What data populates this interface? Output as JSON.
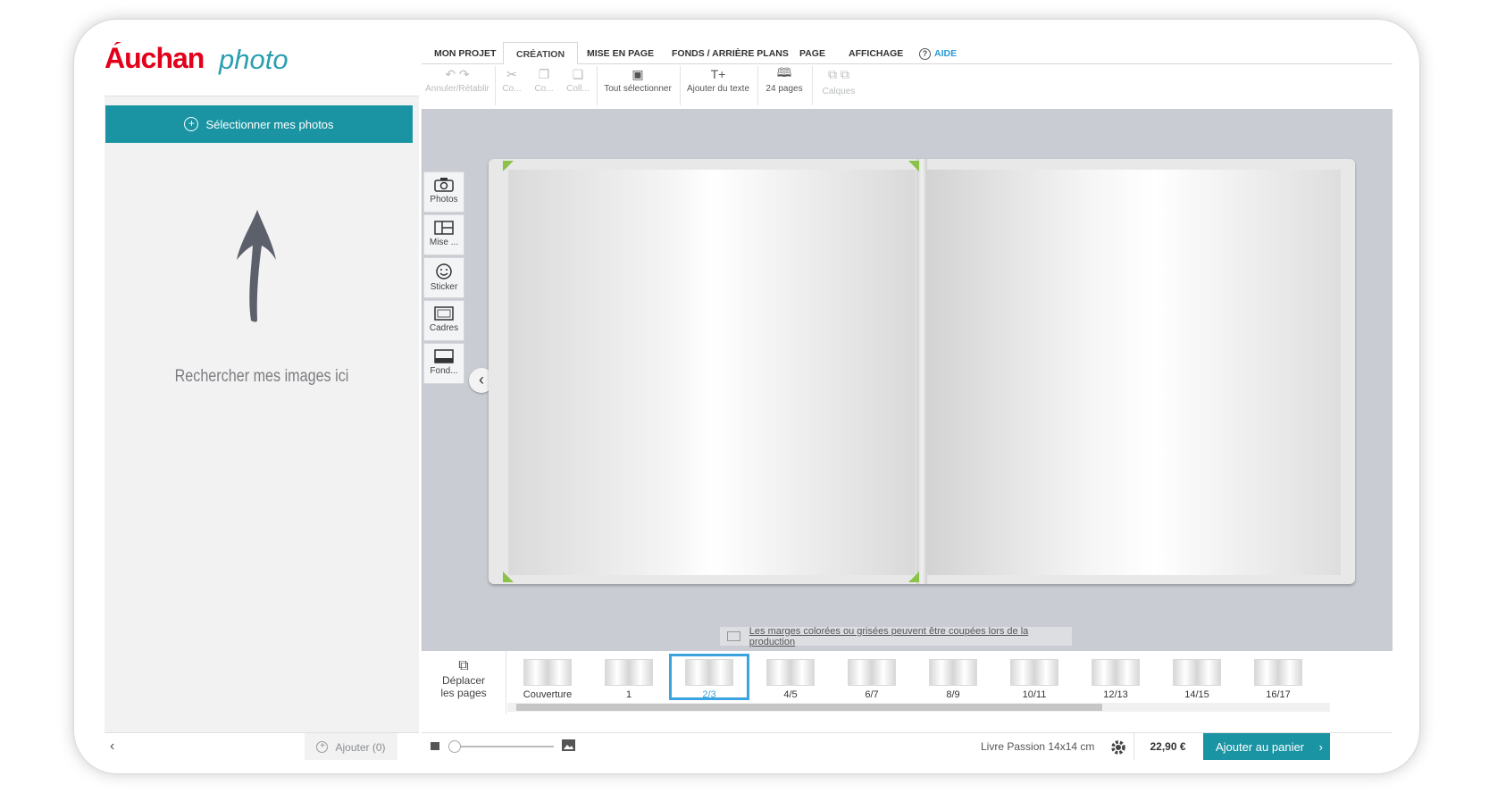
{
  "brand": {
    "name_red": "Auchan",
    "name_blue": "photo"
  },
  "left": {
    "select_button": "Sélectionner mes photos",
    "hint": "Rechercher mes images ici",
    "add_button": "Ajouter (0)"
  },
  "menu": {
    "tabs": [
      "MON PROJET",
      "CRÉATION",
      "MISE EN PAGE",
      "FONDS / ARRIÈRE PLANS",
      "PAGE",
      "AFFICHAGE"
    ],
    "help": "AIDE",
    "active_tab": "CRÉATION"
  },
  "toolbar": {
    "undo_redo": "Annuler/Rétablir",
    "cut": "Co...",
    "copy": "Co...",
    "paste": "Coll...",
    "select_all": "Tout sélectionner",
    "add_text": "Ajouter du texte",
    "pages": "24 pages",
    "layers": "Calques"
  },
  "side_tools": [
    "Photos",
    "Mise ...",
    "Sticker",
    "Cadres",
    "Fond..."
  ],
  "warning": "Les marges colorées ou grisées peuvent être coupées lors de la production",
  "strip": {
    "move_pages": [
      "Déplacer",
      "les pages"
    ],
    "thumbs": [
      "Couverture",
      "1",
      "2/3",
      "4/5",
      "6/7",
      "8/9",
      "10/11",
      "12/13",
      "14/15",
      "16/17"
    ],
    "active_thumb": "2/3"
  },
  "footer": {
    "product": "Livre Passion 14x14 cm",
    "price": "22,90 €",
    "cart_button": "Ajouter au panier"
  },
  "colors": {
    "accent": "#1a94a3",
    "brand_red": "#e2001a",
    "brand_blue": "#2a9fb0",
    "selection": "#3aa3e0"
  }
}
